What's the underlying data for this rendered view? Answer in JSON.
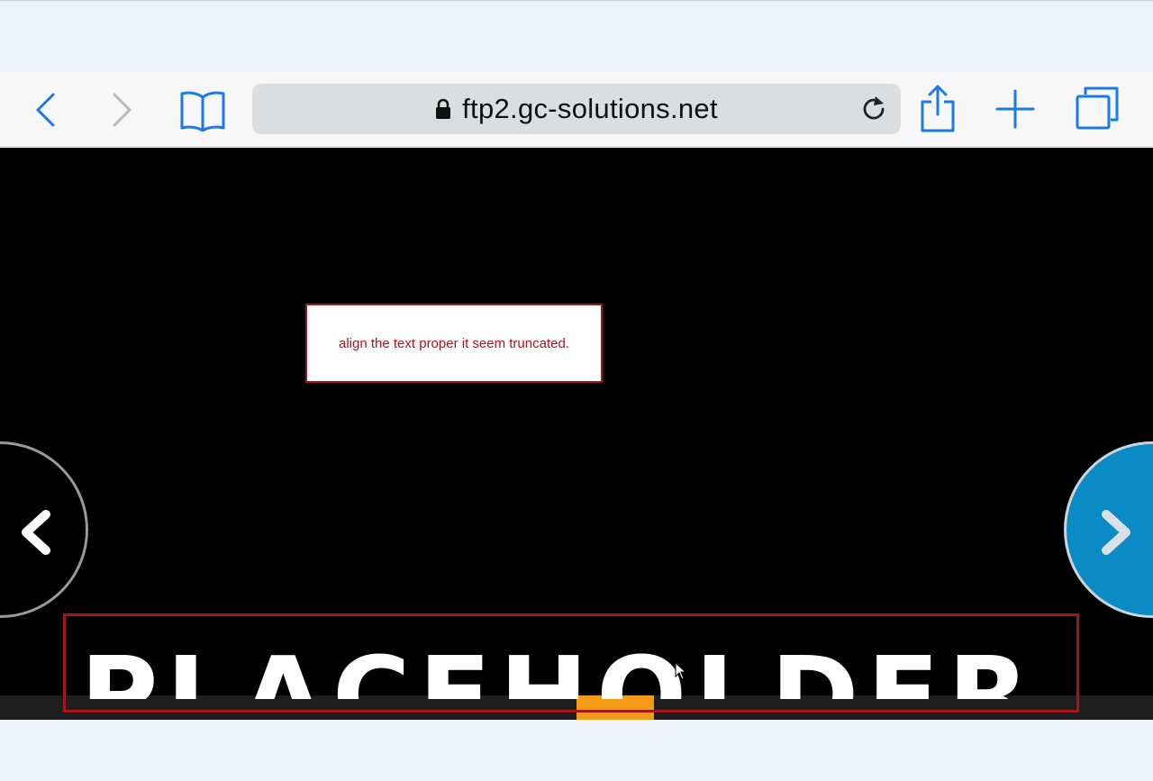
{
  "browser": {
    "url": "ftp2.gc-solutions.net",
    "accent_color": "#1a7ae8",
    "icons": [
      "back-icon",
      "forward-icon",
      "bookmarks-icon",
      "lock-icon",
      "reload-icon",
      "share-icon",
      "new-tab-icon",
      "tabs-icon"
    ]
  },
  "page": {
    "annotation": "align the text proper it seem truncated.",
    "banner_text": "PLACEHOLDER",
    "prev_icon": "chevron-left-icon",
    "next_icon": "chevron-right-icon",
    "accent_blue": "#0a8bc6",
    "highlight_orange": "#f49b15",
    "annotation_color": "#b3121a"
  }
}
